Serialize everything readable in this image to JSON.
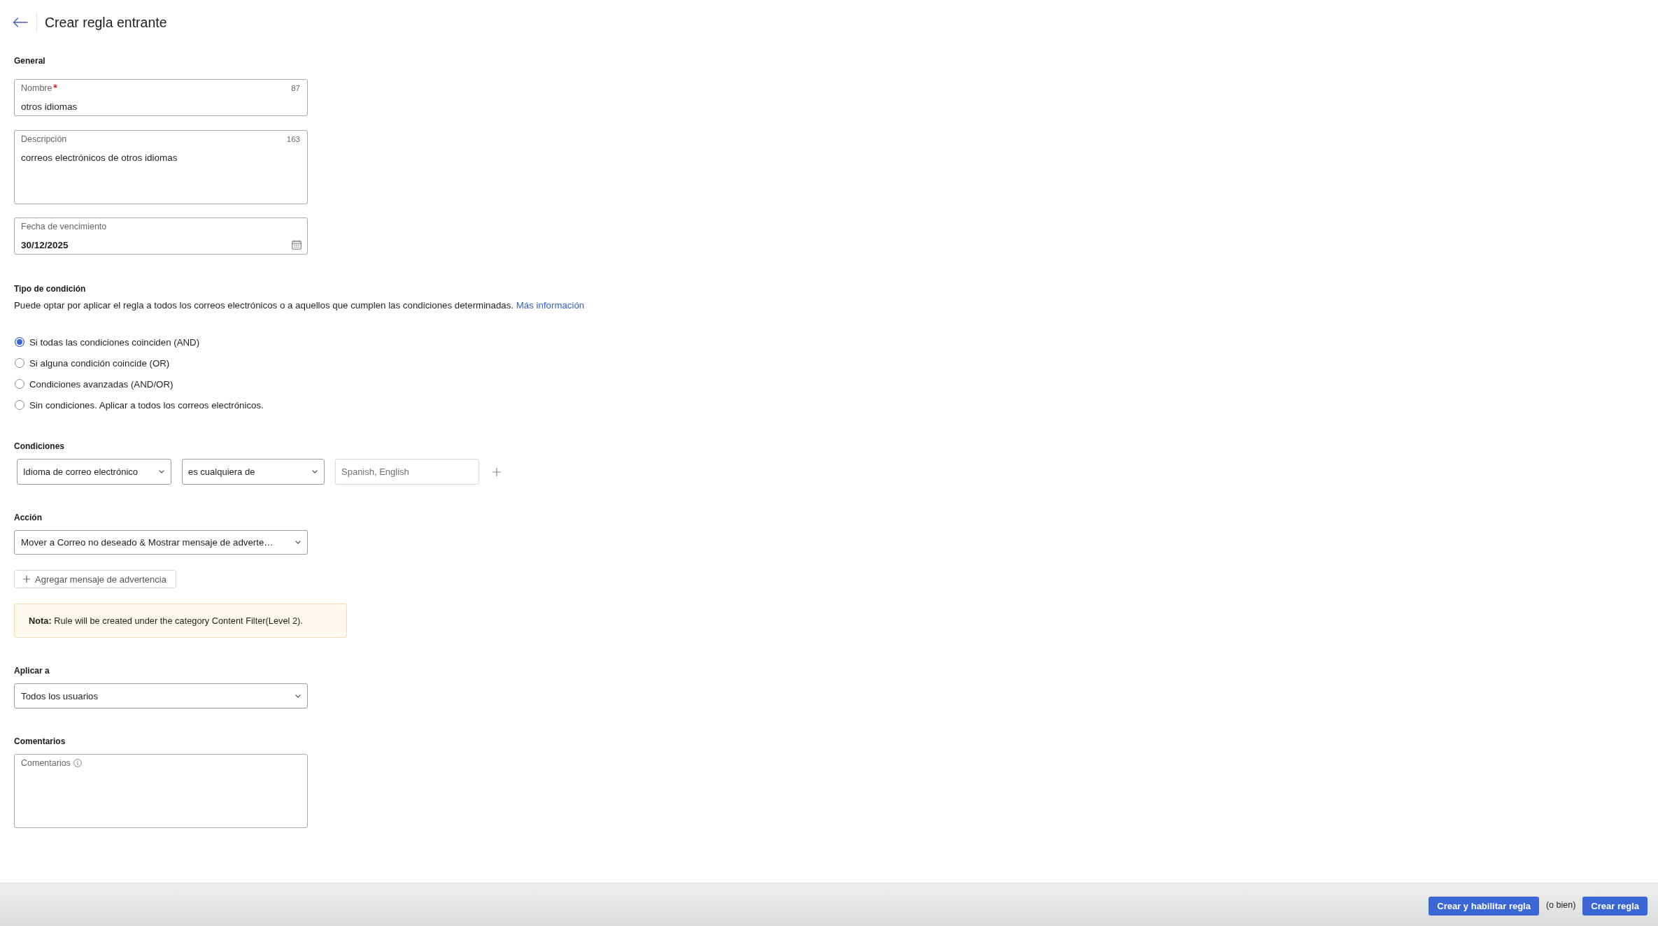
{
  "header": {
    "title": "Crear regla entrante"
  },
  "general": {
    "heading": "General",
    "fields": [
      {
        "kind": "text",
        "label": "Nombre",
        "required": true,
        "counter": "87",
        "value": "otros idiomas"
      },
      {
        "kind": "textarea",
        "label": "Descripción",
        "required": false,
        "counter": "163",
        "value": "correos electrónicos de otros idiomas"
      },
      {
        "kind": "date",
        "label": "Fecha de vencimiento",
        "required": false,
        "value": "30/12/2025"
      }
    ]
  },
  "condition_type": {
    "heading": "Tipo de condición",
    "description": "Puede optar por aplicar el regla a todos los correos electrónicos o a aquellos que cumplen las condiciones determinadas.",
    "link": "Más información",
    "options": [
      {
        "label": "Si todas las condiciones coinciden (AND)",
        "selected": true
      },
      {
        "label": "Si alguna condición coincide (OR)",
        "selected": false
      },
      {
        "label": "Condiciones avanzadas (AND/OR)",
        "selected": false
      },
      {
        "label": "Sin condiciones. Aplicar a todos los correos electrónicos.",
        "selected": false
      }
    ]
  },
  "conditions": {
    "heading": "Condiciones",
    "rows": [
      {
        "field": "Idioma de correo electrónico",
        "operator": "es cualquiera de",
        "placeholder": "Spanish, English"
      }
    ]
  },
  "action": {
    "heading": "Acción",
    "value": "Mover a Correo no deseado & Mostrar mensaje de adverte…",
    "add_button": "Agregar mensaje de advertencia",
    "note": "**Nota:** Rule will be created under the category Content Filter(Level 2)."
  },
  "apply_to": {
    "heading": "Aplicar a",
    "value": "Todos los usuarios"
  },
  "comments": {
    "heading": "Comentarios",
    "label": "Comentarios"
  },
  "footer": {
    "items": [
      {
        "kind": "button",
        "label": "Crear y habilitar regla"
      },
      {
        "kind": "text",
        "label": "(o bien)"
      },
      {
        "kind": "button",
        "label": "Crear regla"
      }
    ]
  }
}
